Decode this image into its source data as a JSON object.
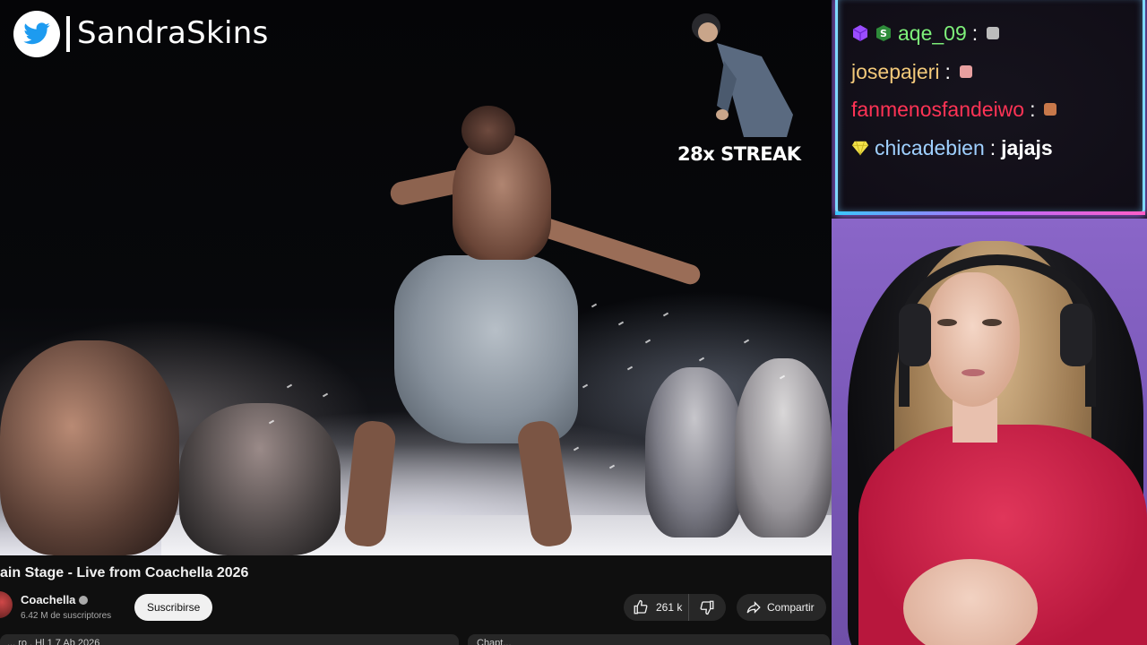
{
  "video": {
    "watermark_handle": "SandraSkins",
    "streak_label": "28x STREAK"
  },
  "youtube": {
    "title_visible": "ain Stage - Live from Coachella 2026",
    "channel_name": "Coachella",
    "subscribers": "6.42 M de suscriptores",
    "subscribe_label": "Suscribirse",
    "like_count": "261 k",
    "share_label": "Compartir",
    "desc_cut_text": "... ro  . Hl  1 7 Ab  2026",
    "comments_cut_text": "Chapt..."
  },
  "chat": {
    "messages": [
      {
        "name": "aqe_09",
        "color": "#7ef07a",
        "message": "",
        "badges": [
          "cube-badge",
          "sub-badge"
        ],
        "emote": "#bcbcbc"
      },
      {
        "name": "josepajeri",
        "color": "#f3c97a",
        "message": "",
        "badges": [],
        "emote": "#e8a0a0"
      },
      {
        "name": "fanmenosfandeiwo",
        "color": "#ff3355",
        "message": "",
        "badges": [],
        "emote": "#c8784a"
      },
      {
        "name": "chicadebien",
        "color": "#9fd0ff",
        "message": "jajajs",
        "badges": [
          "gem-badge"
        ],
        "emote": ""
      }
    ],
    "colors": {
      "frame": "#7fd9ff",
      "glow": "#b66bff"
    }
  },
  "colors": {
    "yt_background": "#0f0f0f",
    "pill": "#272727",
    "webcam_wall": "#7a58b8",
    "shirt": "#c81f45"
  }
}
